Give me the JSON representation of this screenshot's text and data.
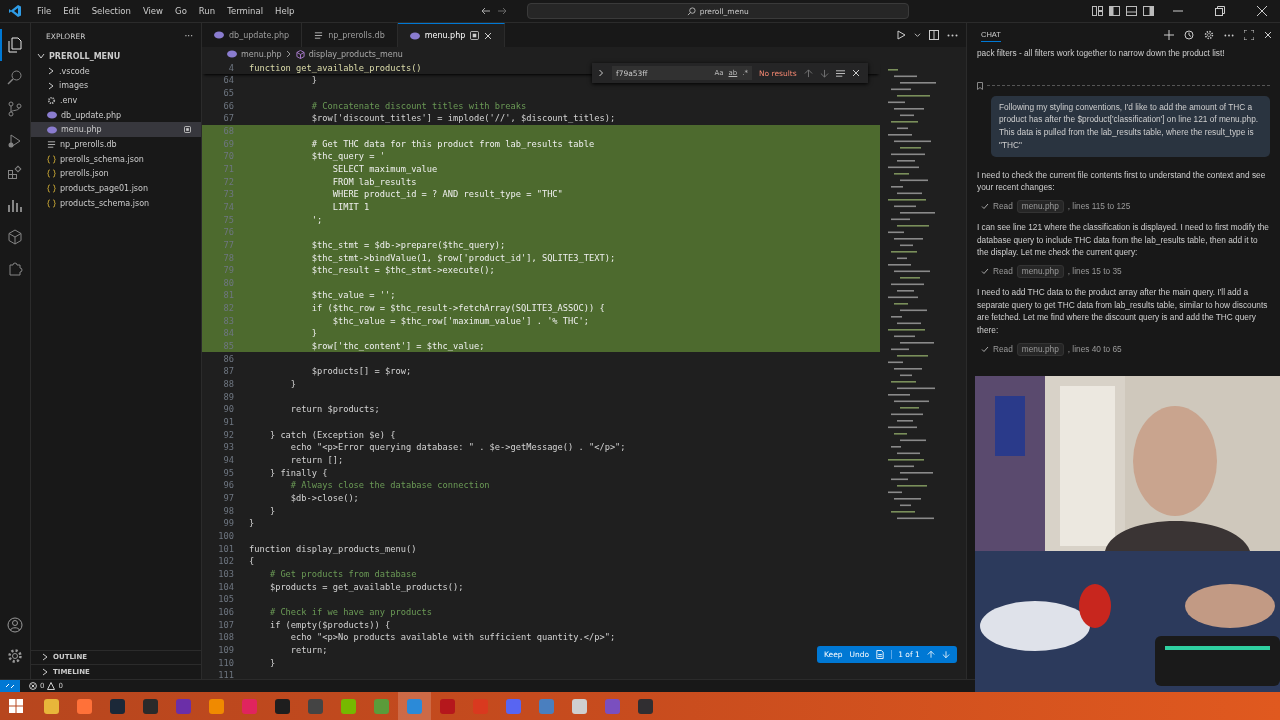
{
  "menu": [
    "File",
    "Edit",
    "Selection",
    "View",
    "Go",
    "Run",
    "Terminal",
    "Help"
  ],
  "command_center": {
    "value": "preroll_menu"
  },
  "activity_bar": [
    {
      "kind": "files",
      "selected": true
    },
    {
      "kind": "search",
      "selected": false
    },
    {
      "kind": "source-control",
      "selected": false
    },
    {
      "kind": "run",
      "selected": false
    },
    {
      "kind": "extensions",
      "selected": false
    },
    {
      "kind": "chart",
      "selected": false
    },
    {
      "kind": "box",
      "selected": false
    },
    {
      "kind": "puzzle",
      "selected": false
    }
  ],
  "sidebar": {
    "title": "EXPLORER",
    "more": "···",
    "root": {
      "label": "PREROLL_MENU",
      "expanded": true,
      "children": [
        {
          "label": ".vscode",
          "kind": "folder",
          "expanded": false
        },
        {
          "label": "images",
          "kind": "folder",
          "expanded": false
        },
        {
          "label": ".env",
          "kind": "env",
          "selected": false,
          "modified": false
        },
        {
          "label": "db_update.php",
          "kind": "php",
          "selected": false,
          "modified": false
        },
        {
          "label": "menu.php",
          "kind": "php",
          "selected": true,
          "modified": true
        },
        {
          "label": "np_prerolls.db",
          "kind": "db",
          "selected": false,
          "modified": false
        },
        {
          "label": "prerolls_schema.json",
          "kind": "json",
          "selected": false,
          "modified": false
        },
        {
          "label": "prerolls.json",
          "kind": "json",
          "selected": false,
          "modified": false
        },
        {
          "label": "products_page01.json",
          "kind": "json",
          "selected": false,
          "modified": false
        },
        {
          "label": "products_schema.json",
          "kind": "json",
          "selected": false,
          "modified": false
        }
      ]
    },
    "sections": [
      {
        "label": "OUTLINE",
        "expanded": false
      },
      {
        "label": "TIMELINE",
        "expanded": false
      }
    ]
  },
  "tabs": [
    {
      "label": "db_update.php",
      "kind": "php",
      "selected": false,
      "modified": false
    },
    {
      "label": "np_prerolls.db",
      "kind": "db",
      "selected": false,
      "modified": false
    },
    {
      "label": "menu.php",
      "kind": "php",
      "selected": true,
      "modified": true
    }
  ],
  "breadcrumbs": [
    "menu.php",
    "display_products_menu"
  ],
  "editor": {
    "sticky": {
      "num": "4",
      "text": "function get_available_products()"
    },
    "lines": [
      {
        "num": "64",
        "added": false,
        "kind": "code",
        "text": "            }"
      },
      {
        "num": "65",
        "added": false
      },
      {
        "num": "66",
        "added": false,
        "kind": "comment",
        "text": "            # Concatenate discount titles with breaks"
      },
      {
        "num": "67",
        "added": false,
        "kind": "code",
        "text": "            $row['discount_titles'] = implode('//', $discount_titles);"
      },
      {
        "num": "68",
        "added": true
      },
      {
        "num": "69",
        "added": true,
        "kind": "comment",
        "text": "            # Get THC data for this product from lab_results table"
      },
      {
        "num": "70",
        "added": true,
        "kind": "code",
        "text": "            $thc_query = '"
      },
      {
        "num": "71",
        "added": true,
        "kind": "string",
        "text": "                SELECT maximum_value"
      },
      {
        "num": "72",
        "added": true,
        "kind": "string",
        "text": "                FROM lab_results"
      },
      {
        "num": "73",
        "added": true,
        "kind": "string",
        "text": "                WHERE product_id = ? AND result_type = \"THC\""
      },
      {
        "num": "74",
        "added": true,
        "kind": "string",
        "text": "                LIMIT 1"
      },
      {
        "num": "75",
        "added": true,
        "kind": "code",
        "text": "            ';"
      },
      {
        "num": "76",
        "added": true
      },
      {
        "num": "77",
        "added": true,
        "kind": "code",
        "text": "            $thc_stmt = $db->prepare($thc_query);"
      },
      {
        "num": "78",
        "added": true,
        "kind": "code",
        "text": "            $thc_stmt->bindValue(1, $row['product_id'], SQLITE3_TEXT);"
      },
      {
        "num": "79",
        "added": true,
        "kind": "code",
        "text": "            $thc_result = $thc_stmt->execute();"
      },
      {
        "num": "80",
        "added": true
      },
      {
        "num": "81",
        "added": true,
        "kind": "code",
        "text": "            $thc_value = '';"
      },
      {
        "num": "82",
        "added": true,
        "kind": "code",
        "text": "            if ($thc_row = $thc_result->fetchArray(SQLITE3_ASSOC)) {"
      },
      {
        "num": "83",
        "added": true,
        "kind": "code",
        "text": "                $thc_value = $thc_row['maximum_value'] . '% THC';"
      },
      {
        "num": "84",
        "added": true,
        "kind": "code",
        "text": "            }"
      },
      {
        "num": "85",
        "added": true,
        "kind": "code",
        "text": "            $row['thc_content'] = $thc_value;"
      },
      {
        "num": "86",
        "added": false
      },
      {
        "num": "87",
        "added": false,
        "kind": "code",
        "text": "            $products[] = $row;"
      },
      {
        "num": "88",
        "added": false,
        "kind": "code",
        "text": "        }"
      },
      {
        "num": "89",
        "added": false
      },
      {
        "num": "90",
        "added": false,
        "kind": "code",
        "text": "        return $products;"
      },
      {
        "num": "91",
        "added": false
      },
      {
        "num": "92",
        "added": false,
        "kind": "code",
        "text": "    } catch (Exception $e) {"
      },
      {
        "num": "93",
        "added": false,
        "kind": "code",
        "text": "        echo \"<p>Error querying database: \" . $e->getMessage() . \"</p>\";"
      },
      {
        "num": "94",
        "added": false,
        "kind": "code",
        "text": "        return [];"
      },
      {
        "num": "95",
        "added": false,
        "kind": "code",
        "text": "    } finally {"
      },
      {
        "num": "96",
        "added": false,
        "kind": "comment",
        "text": "        # Always close the database connection"
      },
      {
        "num": "97",
        "added": false,
        "kind": "code",
        "text": "        $db->close();"
      },
      {
        "num": "98",
        "added": false,
        "kind": "code",
        "text": "    }"
      },
      {
        "num": "99",
        "added": false,
        "kind": "code",
        "text": "}"
      },
      {
        "num": "100",
        "added": false
      },
      {
        "num": "101",
        "added": false,
        "kind": "code",
        "text": "function display_products_menu()"
      },
      {
        "num": "102",
        "added": false,
        "kind": "code",
        "text": "{"
      },
      {
        "num": "103",
        "added": false,
        "kind": "comment",
        "text": "    # Get products from database"
      },
      {
        "num": "104",
        "added": false,
        "kind": "code",
        "text": "    $products = get_available_products();"
      },
      {
        "num": "105",
        "added": false
      },
      {
        "num": "106",
        "added": false,
        "kind": "comment",
        "text": "    # Check if we have any products"
      },
      {
        "num": "107",
        "added": false,
        "kind": "code",
        "text": "    if (empty($products)) {"
      },
      {
        "num": "108",
        "added": false,
        "kind": "code",
        "text": "        echo \"<p>No products available with sufficient quantity.</p>\";"
      },
      {
        "num": "109",
        "added": false,
        "kind": "code",
        "text": "        return;"
      },
      {
        "num": "110",
        "added": false,
        "kind": "code",
        "text": "    }"
      },
      {
        "num": "111",
        "added": false
      }
    ]
  },
  "find": {
    "value": "f79a53ff",
    "match_case": "Aa",
    "whole_word": "ab",
    "regex": ".*",
    "result": "No results"
  },
  "review_bar": {
    "keep": "Keep",
    "undo": "Undo",
    "count": "1 of 1"
  },
  "chat": {
    "title": "CHAT",
    "messages": [
      {
        "kind": "text",
        "text": "pack filters - all filters work together to narrow down the product list!"
      },
      {
        "kind": "user",
        "text": "Following my styling conventions, I'd like to add the amount of THC a product has after the $product['classification'] on line 121 of menu.php. This data is pulled from the lab_results table, where the result_type is \"THC\""
      },
      {
        "kind": "text",
        "text": "I need to check the current file contents first to understand the context and see your recent changes:"
      },
      {
        "kind": "tool",
        "verb": "Read",
        "file": "menu.php",
        "range": ", lines 115 to 125"
      },
      {
        "kind": "text",
        "text": "I can see line 121 where the classification is displayed. I need to first modify the database query to include THC data from the lab_results table, then add it to the display. Let me check the current query:"
      },
      {
        "kind": "tool",
        "verb": "Read",
        "file": "menu.php",
        "range": ", lines 15 to 35"
      },
      {
        "kind": "text",
        "text": "I need to add THC data to the product array after the main query. I'll add a separate query to get THC data from lab_results table, similar to how discounts are fetched. Let me find where the discount query is and add the THC query there:"
      },
      {
        "kind": "tool",
        "verb": "Read",
        "file": "menu.php",
        "range": ", lines 40 to 65"
      }
    ]
  },
  "status_bar": {
    "errors": "0",
    "warnings": "0"
  },
  "taskbar": [
    {
      "color": "#e8b63a",
      "selected": false
    },
    {
      "color": "#ff7139",
      "selected": false
    },
    {
      "color": "#1b2838",
      "selected": false
    },
    {
      "color": "#2a2a2a",
      "selected": false
    },
    {
      "color": "#6b2fa8",
      "selected": false
    },
    {
      "color": "#f08a00",
      "selected": false
    },
    {
      "color": "#e0245e",
      "selected": false
    },
    {
      "color": "#1e1e1e",
      "selected": false
    },
    {
      "color": "#444444",
      "selected": false
    },
    {
      "color": "#76b900",
      "selected": false
    },
    {
      "color": "#5b9c3a",
      "selected": false
    },
    {
      "color": "#2b8ad8",
      "selected": true
    },
    {
      "color": "#b5171c",
      "selected": false
    },
    {
      "color": "#d9391f",
      "selected": false
    },
    {
      "color": "#5865f2",
      "selected": false
    },
    {
      "color": "#4a7fbf",
      "selected": false
    },
    {
      "color": "#cfcfcf",
      "selected": false
    },
    {
      "color": "#7a4fbf",
      "selected": false
    },
    {
      "color": "#302e31",
      "selected": false
    }
  ]
}
